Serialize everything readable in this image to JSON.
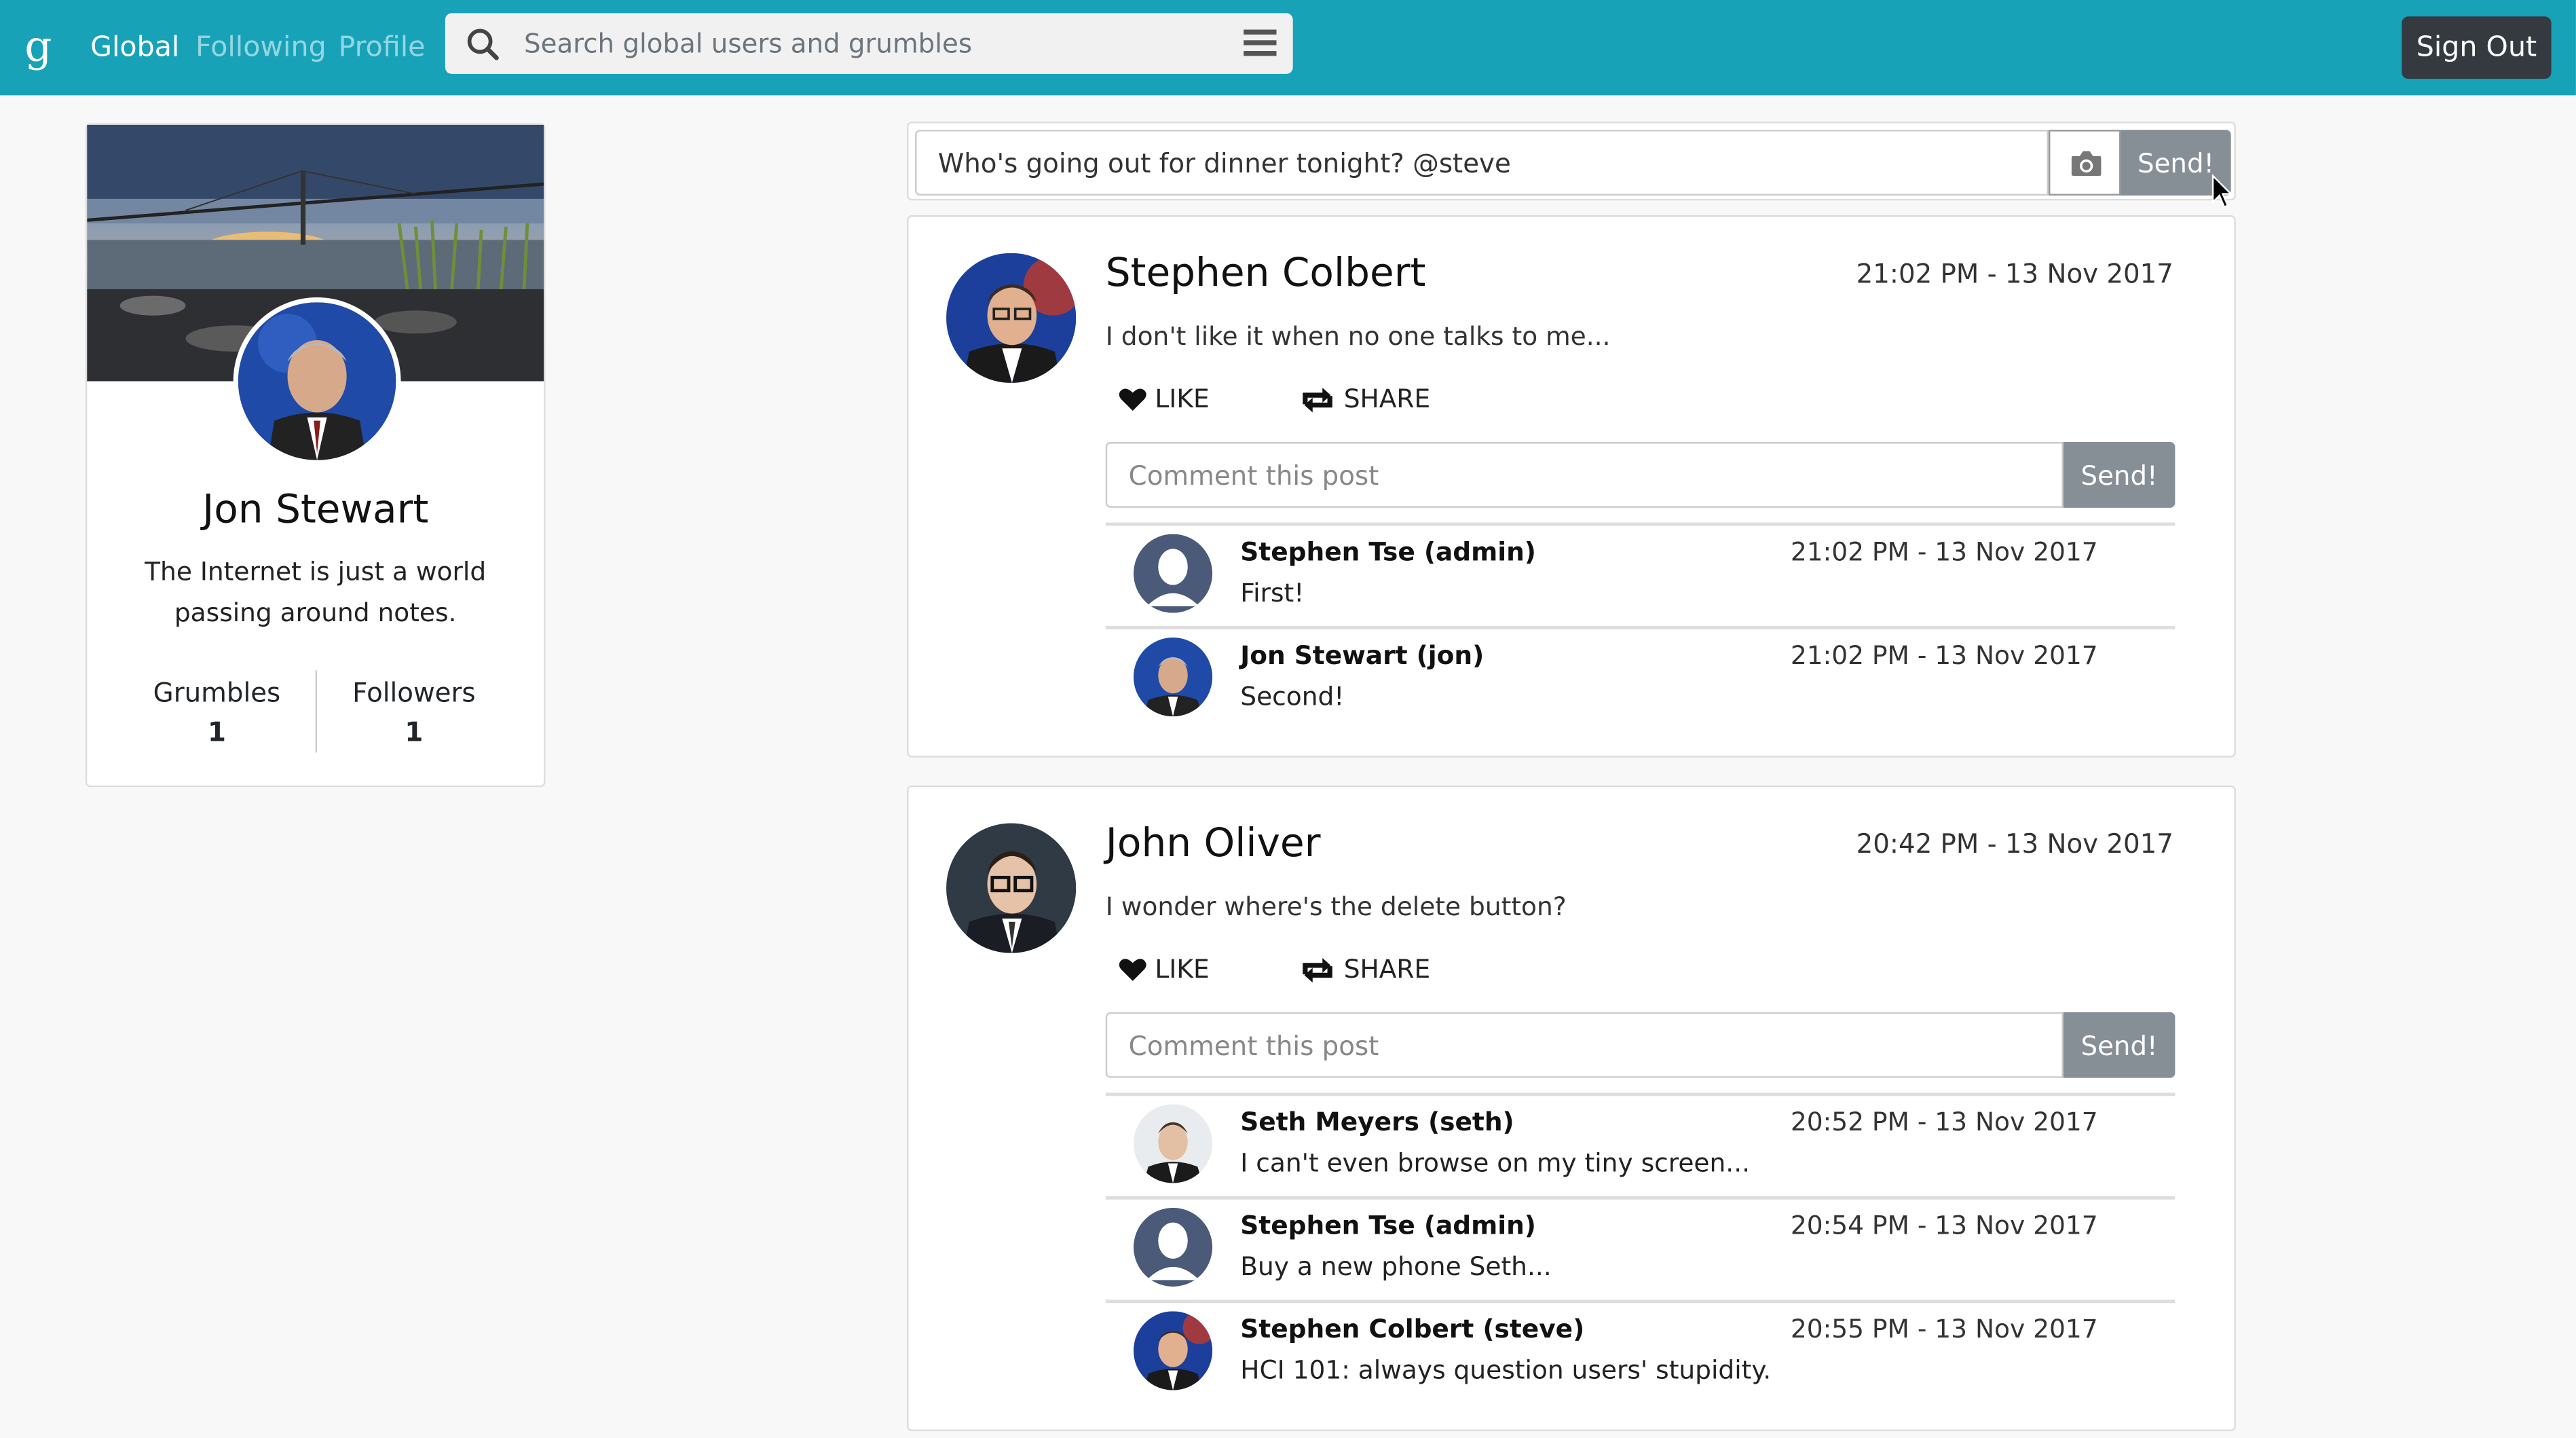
{
  "nav": {
    "brand": "g",
    "links": [
      "Global",
      "Following",
      "Profile"
    ],
    "search_placeholder": "Search global users and grumbles",
    "sign_out": "Sign Out",
    "accent": "#17a2b8"
  },
  "profile": {
    "name": "Jon Stewart",
    "bio": "The Internet is just a world passing around notes.",
    "stats": [
      {
        "label": "Grumbles",
        "value": "1"
      },
      {
        "label": "Followers",
        "value": "1"
      }
    ]
  },
  "compose": {
    "value": "Who's going out for dinner tonight? @steve",
    "camera_icon": "camera-icon",
    "send_label": "Send!"
  },
  "posts": [
    {
      "author": "Stephen Colbert",
      "time": "21:02 PM - 13 Nov 2017",
      "body": "I don't like it when no one talks to me...",
      "like_label": "LIKE",
      "share_label": "SHARE",
      "comment_placeholder": "Comment this post",
      "comment_send": "Send!",
      "comments": [
        {
          "name": "Stephen Tse (admin)",
          "time": "21:02 PM - 13 Nov 2017",
          "text": "First!"
        },
        {
          "name": "Jon Stewart (jon)",
          "time": "21:02 PM - 13 Nov 2017",
          "text": "Second!"
        }
      ]
    },
    {
      "author": "John Oliver",
      "time": "20:42 PM - 13 Nov 2017",
      "body": "I wonder where's the delete button?",
      "like_label": "LIKE",
      "share_label": "SHARE",
      "comment_placeholder": "Comment this post",
      "comment_send": "Send!",
      "comments": [
        {
          "name": "Seth Meyers (seth)",
          "time": "20:52 PM - 13 Nov 2017",
          "text": "I can't even browse on my tiny screen..."
        },
        {
          "name": "Stephen Tse (admin)",
          "time": "20:54 PM - 13 Nov 2017",
          "text": "Buy a new phone Seth..."
        },
        {
          "name": "Stephen Colbert (steve)",
          "time": "20:55 PM - 13 Nov 2017",
          "text": "HCI 101: always question users' stupidity."
        }
      ]
    }
  ]
}
